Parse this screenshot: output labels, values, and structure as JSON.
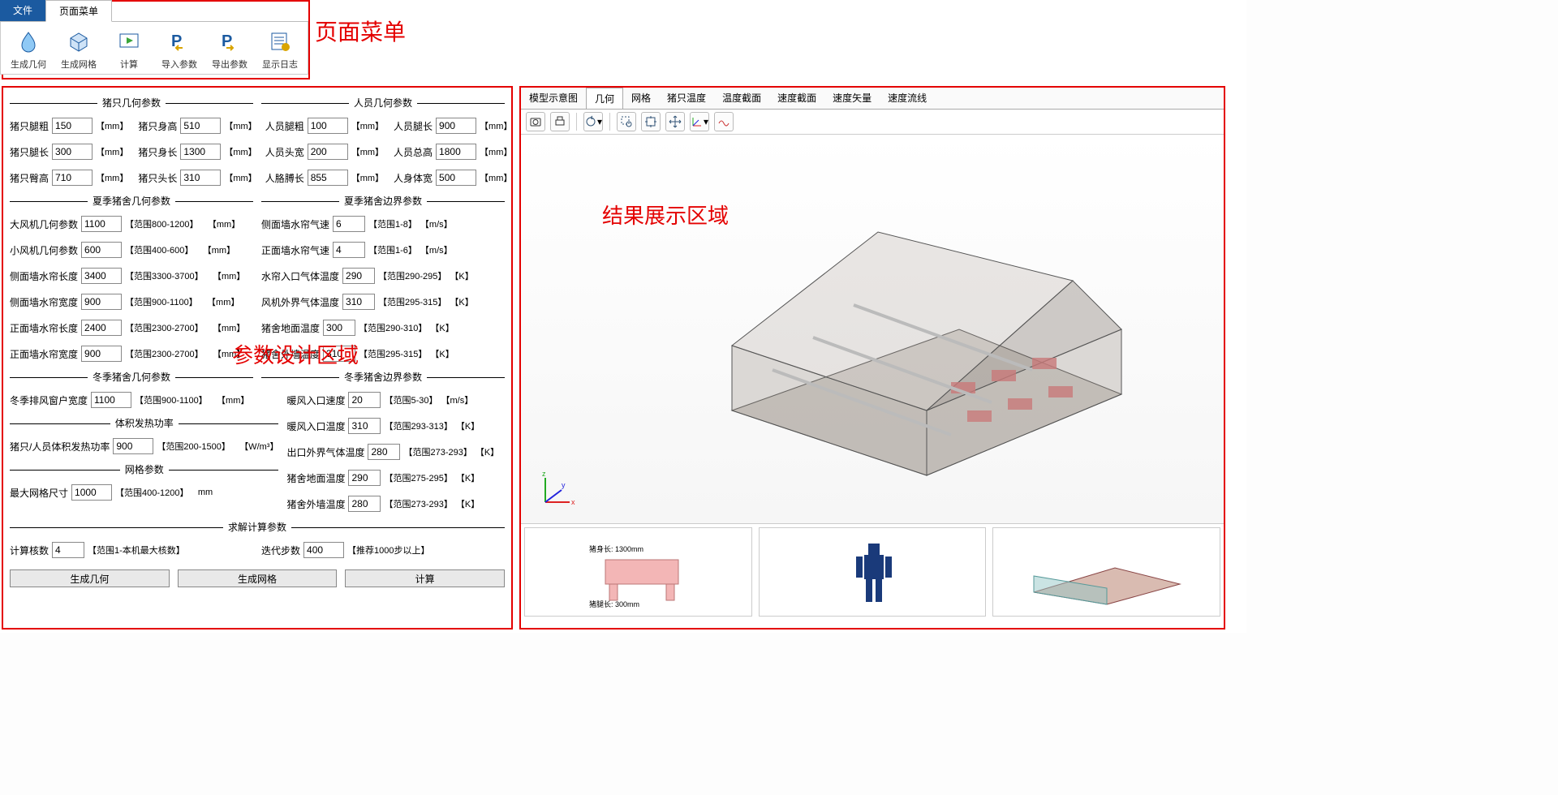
{
  "ribbon": {
    "tab_file": "文件",
    "tab_menu": "页面菜单",
    "items": [
      {
        "label": "生成几何"
      },
      {
        "label": "生成网格"
      },
      {
        "label": "计算"
      },
      {
        "label": "导入参数"
      },
      {
        "label": "导出参数"
      },
      {
        "label": "显示日志"
      }
    ]
  },
  "annotations": {
    "top": "页面菜单",
    "left": "参数设计区域",
    "right": "结果展示区域"
  },
  "sections": {
    "pig_geom": "猪只几何参数",
    "person_geom": "人员几何参数",
    "summer_geom": "夏季猪舍几何参数",
    "summer_bound": "夏季猪舍边界参数",
    "winter_geom": "冬季猪舍几何参数",
    "winter_bound": "冬季猪舍边界参数",
    "heat": "体积发热功率",
    "mesh": "网格参数",
    "solver": "求解计算参数"
  },
  "pig": {
    "leg_thick": {
      "label": "猪只腿粗",
      "value": "150",
      "unit": "【mm】"
    },
    "leg_len": {
      "label": "猪只腿长",
      "value": "300",
      "unit": "【mm】"
    },
    "hip_h": {
      "label": "猪只臀高",
      "value": "710",
      "unit": "【mm】"
    },
    "body_h": {
      "label": "猪只身高",
      "value": "510",
      "unit": "【mm】"
    },
    "body_l": {
      "label": "猪只身长",
      "value": "1300",
      "unit": "【mm】"
    },
    "head_l": {
      "label": "猪只头长",
      "value": "310",
      "unit": "【mm】"
    }
  },
  "person": {
    "leg_thick": {
      "label": "人员腿粗",
      "value": "100",
      "unit": "【mm】"
    },
    "head_w": {
      "label": "人员头宽",
      "value": "200",
      "unit": "【mm】"
    },
    "arm_l": {
      "label": "人胳膊长",
      "value": "855",
      "unit": "【mm】"
    },
    "leg_l": {
      "label": "人员腿长",
      "value": "900",
      "unit": "【mm】"
    },
    "total_h": {
      "label": "人员总高",
      "value": "1800",
      "unit": "【mm】"
    },
    "body_w": {
      "label": "人身体宽",
      "value": "500",
      "unit": "【mm】"
    }
  },
  "summer_geom": {
    "big_fan": {
      "label": "大风机几何参数",
      "value": "1100",
      "range": "【范围800-1200】",
      "unit": "【mm】"
    },
    "small_fan": {
      "label": "小风机几何参数",
      "value": "600",
      "range": "【范围400-600】",
      "unit": "【mm】"
    },
    "side_len": {
      "label": "侧面墙水帘长度",
      "value": "3400",
      "range": "【范围3300-3700】",
      "unit": "【mm】"
    },
    "side_wid": {
      "label": "侧面墙水帘宽度",
      "value": "900",
      "range": "【范围900-1100】",
      "unit": "【mm】"
    },
    "front_len": {
      "label": "正面墙水帘长度",
      "value": "2400",
      "range": "【范围2300-2700】",
      "unit": "【mm】"
    },
    "front_wid": {
      "label": "正面墙水帘宽度",
      "value": "900",
      "range": "【范围2300-2700】",
      "unit": "【mm】"
    }
  },
  "summer_bound": {
    "side_vel": {
      "label": "侧面墙水帘气速",
      "value": "6",
      "range": "【范围1-8】",
      "unit": "【m/s】"
    },
    "front_vel": {
      "label": "正面墙水帘气速",
      "value": "4",
      "range": "【范围1-6】",
      "unit": "【m/s】"
    },
    "inlet_t": {
      "label": "水帘入口气体温度",
      "value": "290",
      "range": "【范围290-295】",
      "unit": "【K】"
    },
    "fan_t": {
      "label": "风机外界气体温度",
      "value": "310",
      "range": "【范围295-315】",
      "unit": "【K】"
    },
    "ground_t": {
      "label": "猪舍地面温度",
      "value": "300",
      "range": "【范围290-310】",
      "unit": "【K】"
    },
    "wall_t": {
      "label": "猪舍外墙温度",
      "value": "310",
      "range": "【范围295-315】",
      "unit": "【K】"
    }
  },
  "winter_geom": {
    "exhaust": {
      "label": "冬季排风窗户宽度",
      "value": "1100",
      "range": "【范围900-1100】",
      "unit": "【mm】"
    }
  },
  "winter_bound": {
    "warm_vel": {
      "label": "暖风入口速度",
      "value": "20",
      "range": "【范围5-30】",
      "unit": "【m/s】"
    },
    "warm_t": {
      "label": "暖风入口温度",
      "value": "310",
      "range": "【范围293-313】",
      "unit": "【K】"
    },
    "out_t": {
      "label": "出口外界气体温度",
      "value": "280",
      "range": "【范围273-293】",
      "unit": "【K】"
    },
    "ground_t": {
      "label": "猪舍地面温度",
      "value": "290",
      "range": "【范围275-295】",
      "unit": "【K】"
    },
    "wall_t": {
      "label": "猪舍外墙温度",
      "value": "280",
      "range": "【范围273-293】",
      "unit": "【K】"
    }
  },
  "heat": {
    "label": "猪只/人员体积发热功率",
    "value": "900",
    "range": "【范围200-1500】",
    "unit": "【W/m³】"
  },
  "mesh": {
    "label": "最大网格尺寸",
    "value": "1000",
    "range": "【范围400-1200】",
    "unit": "mm"
  },
  "solver": {
    "cores": {
      "label": "计算核数",
      "value": "4",
      "range": "【范围1-本机最大核数】"
    },
    "iters": {
      "label": "迭代步数",
      "value": "400",
      "range": "【推荐1000步以上】"
    }
  },
  "buttons": {
    "geom": "生成几何",
    "mesh": "生成网格",
    "calc": "计算"
  },
  "viewer_tabs": [
    "模型示意图",
    "几何",
    "网格",
    "猪只温度",
    "温度截面",
    "速度截面",
    "速度矢量",
    "速度流线"
  ],
  "axis": {
    "x": "x",
    "y": "y",
    "z": "z"
  }
}
